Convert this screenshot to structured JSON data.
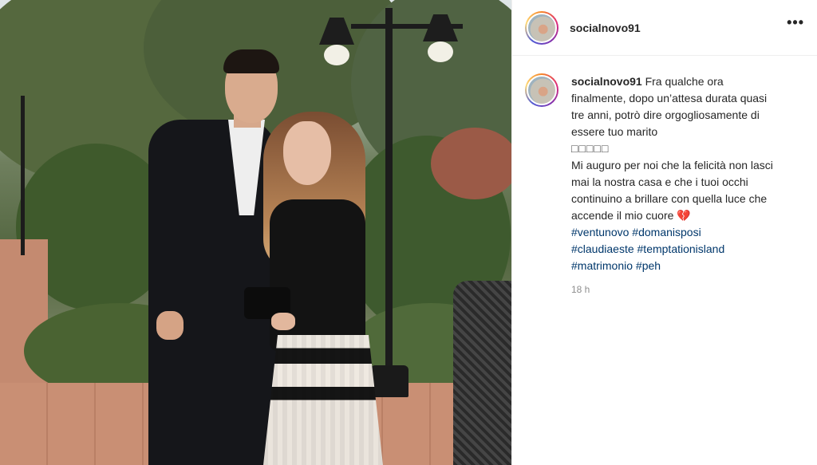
{
  "post": {
    "username": "socialnovo91",
    "caption_line1": "Fra qualche ora finalmente, dopo un’attesa durata quasi tre anni, potrò dire orgogliosamente di essere tuo marito",
    "caption_emojis": "□□□□□",
    "caption_line2": "Mi auguro per noi che la felicità non lasci mai la nostra casa e che i tuoi occhi continuino a brillare con quella luce che accende il mio cuore 💔",
    "hashtags": [
      "#ventunovo",
      "#domanisposi",
      "#claudiaeste",
      "#temptationisland",
      "#matrimonio",
      "#peh"
    ],
    "timestamp": "18 h",
    "more_label": "•••"
  },
  "photo": {
    "description_icon": "photo"
  }
}
